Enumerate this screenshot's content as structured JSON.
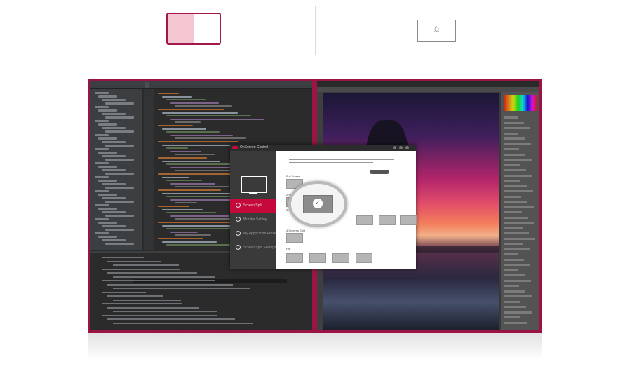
{
  "top_icons": {
    "split_mode": {
      "name": "screen-split-icon",
      "accent": "#a5164a"
    },
    "single_mode": {
      "name": "screen-brightness-icon",
      "glyph": "☼"
    }
  },
  "monitor": {
    "frame_color": "#9c1445"
  },
  "dialog": {
    "title": "OnScreen Control",
    "menu": [
      {
        "label": "Screen Split",
        "active": true
      },
      {
        "label": "Monitor Setting",
        "active": false
      },
      {
        "label": "My Application Preset",
        "active": false
      },
      {
        "label": "Screen Split Settings",
        "active": false
      }
    ],
    "sections": [
      "Full Screen",
      "2 Screens Split",
      "3 Screens Split",
      "4 Screens Split",
      "PIP"
    ]
  }
}
